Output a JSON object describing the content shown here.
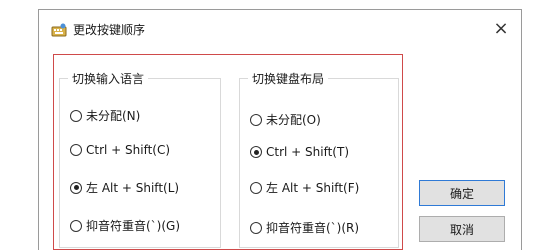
{
  "dialog": {
    "title": "更改按键顺序",
    "close_glyph": "×"
  },
  "input_language_group": {
    "title": "切换输入语言",
    "options": [
      {
        "label": "未分配(N)",
        "checked": false
      },
      {
        "label": "Ctrl + Shift(C)",
        "checked": false
      },
      {
        "label": "左 Alt + Shift(L)",
        "checked": true
      },
      {
        "label": "抑音符重音(`)(G)",
        "checked": false
      }
    ]
  },
  "keyboard_layout_group": {
    "title": "切换键盘布局",
    "options": [
      {
        "label": "未分配(O)",
        "checked": false
      },
      {
        "label": "Ctrl + Shift(T)",
        "checked": true
      },
      {
        "label": "左 Alt + Shift(F)",
        "checked": false
      },
      {
        "label": "抑音符重音(`)(R)",
        "checked": false
      }
    ]
  },
  "buttons": {
    "ok_label": "确定",
    "cancel_label": "取消"
  },
  "colors": {
    "highlight_border": "#cf4a4a",
    "primary_button_border": "#2f7ad6"
  }
}
